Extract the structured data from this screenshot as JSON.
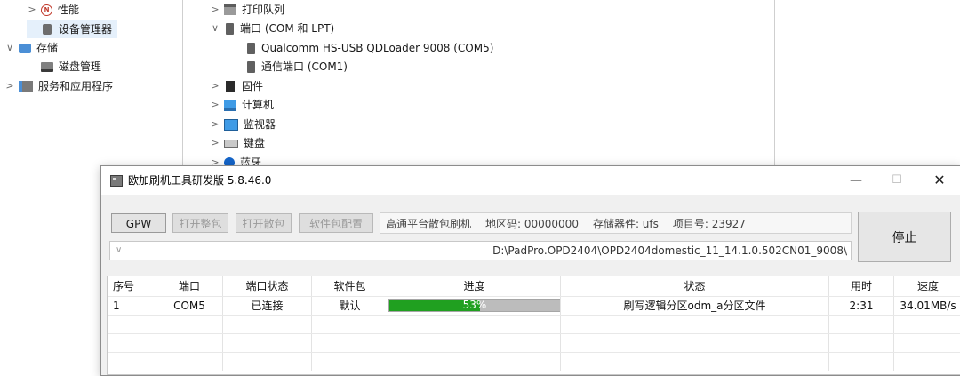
{
  "device_manager": {
    "left_tree": [
      {
        "chevron": ">",
        "icon": "performance-icon",
        "label": "性能"
      },
      {
        "chevron": "",
        "icon": "device-manager-icon",
        "label": "设备管理器"
      },
      {
        "chevron": "∨",
        "icon": "storage-icon",
        "label": "存储"
      },
      {
        "chevron": "",
        "icon": "disk-icon",
        "label": "磁盘管理"
      },
      {
        "chevron": ">",
        "icon": "services-icon",
        "label": "服务和应用程序"
      }
    ],
    "device_tree": [
      {
        "chevron": ">",
        "icon": "print-queue-icon",
        "label": "打印队列"
      },
      {
        "chevron": "∨",
        "icon": "port-icon",
        "label": "端口 (COM 和 LPT)"
      },
      {
        "chevron": "",
        "icon": "port-icon",
        "label": "Qualcomm HS-USB QDLoader 9008 (COM5)"
      },
      {
        "chevron": "",
        "icon": "port-icon",
        "label": "通信端口 (COM1)"
      },
      {
        "chevron": ">",
        "icon": "firmware-icon",
        "label": "固件"
      },
      {
        "chevron": ">",
        "icon": "computer-icon",
        "label": "计算机"
      },
      {
        "chevron": ">",
        "icon": "monitor-icon",
        "label": "监视器"
      },
      {
        "chevron": ">",
        "icon": "keyboard-icon",
        "label": "键盘"
      },
      {
        "chevron": ">",
        "icon": "bluetooth-icon",
        "label": "蓝牙"
      }
    ]
  },
  "app": {
    "title": "欧加刷机工具研发版 5.8.46.0",
    "window_buttons": {
      "minimize": "—",
      "maximize": "☐",
      "close": "✕"
    },
    "toolbar": {
      "gpw": "GPW",
      "open_full": "打开整包",
      "open_scatter": "打开散包",
      "package_config": "软件包配置"
    },
    "info": {
      "mode": "高通平台散包刷机",
      "region": "地区码: 00000000",
      "storage": "存储器件: ufs",
      "project": "项目号: 23927"
    },
    "stop_label": "停止",
    "path": "D:\\PadPro.OPD2404\\OPD2404domestic_11_14.1.0.502CN01_9008\\",
    "path_chevron": "∨",
    "table": {
      "headers": [
        "序号",
        "端口",
        "端口状态",
        "软件包",
        "进度",
        "状态",
        "用时",
        "速度"
      ],
      "rows": [
        {
          "index": "1",
          "port": "COM5",
          "port_status": "已连接",
          "package": "默认",
          "progress_label": "53%",
          "progress": 53,
          "status": "刷写逻辑分区odm_a分区文件",
          "elapsed": "2:31",
          "speed": "34.01MB/s"
        }
      ]
    }
  },
  "colors": {
    "progress_fill": "#20a020",
    "progress_track": "#bcbcbc"
  }
}
